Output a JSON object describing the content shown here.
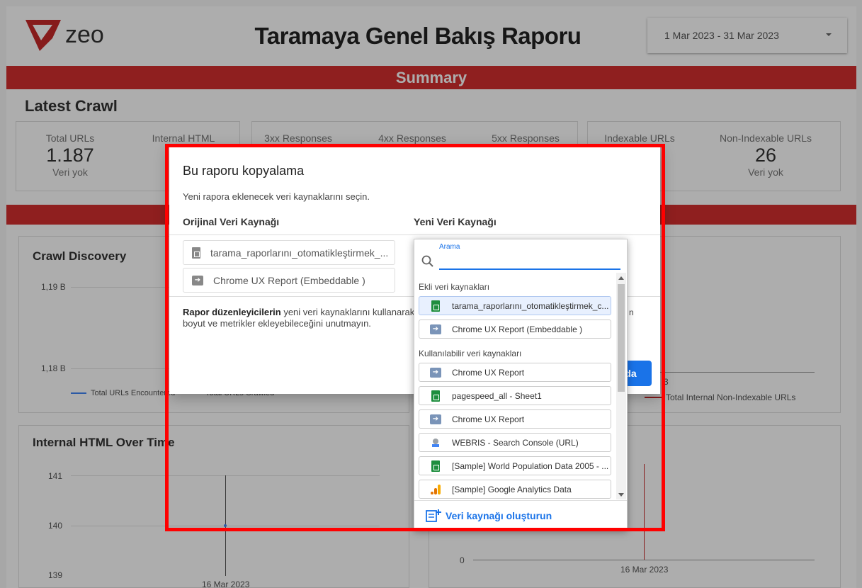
{
  "report": {
    "logo_text": "zeo",
    "title": "Taramaya Genel Bakış Raporu",
    "date_range": "1 Mar 2023 - 31 Mar 2023",
    "summary_band": "Summary",
    "section_title": "Latest Crawl",
    "metrics": [
      {
        "label": "Total URLs",
        "value": "1.187",
        "sub": "Veri yok"
      },
      {
        "label": "Internal HTML",
        "value": "",
        "sub": ""
      },
      {
        "label": "3xx Responses",
        "value": "",
        "sub": ""
      },
      {
        "label": "4xx Responses",
        "value": "",
        "sub": ""
      },
      {
        "label": "5xx Responses",
        "value": "",
        "sub": ""
      },
      {
        "label": "Indexable URLs",
        "value": "",
        "sub": ""
      },
      {
        "label": "Non-Indexable URLs",
        "value": "26",
        "sub": "Veri yok"
      }
    ],
    "crawl_discovery": {
      "title": "Crawl Discovery",
      "y_ticks": [
        "1,19 B",
        "1,18 B"
      ],
      "legend": [
        "Total URLs Encountered",
        "Total URLs Crawled"
      ]
    },
    "internal_html": {
      "title": "Internal HTML Over Time",
      "y_ticks": [
        "141",
        "140",
        "139"
      ],
      "x_tick": "16 Mar 2023"
    },
    "right_chart_top": {
      "x_tick": "3",
      "legend": "Total Internal Non-Indexable URLs"
    },
    "right_chart_bottom": {
      "y_tick": "0",
      "x_tick": "16 Mar 2023"
    }
  },
  "dialog": {
    "title": "Bu raporu kopyalama",
    "description": "Yeni rapora eklenecek veri kaynaklarını seçin.",
    "col_original": "Orijinal Veri Kaynağı",
    "col_new": "Yeni Veri Kaynağı",
    "original_sources": [
      {
        "name": "tarama_raporlarını_otomatikleştirmek_...",
        "icon": "sheet-icon"
      },
      {
        "name": "Chrome UX Report (Embeddable )",
        "icon": "connector-icon"
      }
    ],
    "note_bold": "Rapor düzenleyicilerin",
    "note_rest": " yeni veri kaynaklarını kullanarak g",
    "note_line2": "boyut ve metrikler ekleyebileceğini unutmayın.",
    "note_right_fragment": "n",
    "copy_button": "da"
  },
  "dropdown": {
    "search_label": "Arama",
    "search_value": "",
    "group_added": "Ekli veri kaynakları",
    "added_sources": [
      {
        "name": "tarama_raporlarını_otomatikleştirmek_c...",
        "icon": "sheets-icon",
        "selected": true
      },
      {
        "name": "Chrome UX Report (Embeddable )",
        "icon": "connector-icon",
        "selected": false
      }
    ],
    "group_available": "Kullanılabilir veri kaynakları",
    "available_sources": [
      {
        "name": "Chrome UX Report",
        "icon": "connector-icon"
      },
      {
        "name": "pagespeed_all - Sheet1",
        "icon": "sheets-icon"
      },
      {
        "name": "Chrome UX Report",
        "icon": "connector-icon"
      },
      {
        "name": "WEBRIS - Search Console (URL)",
        "icon": "search-console-icon"
      },
      {
        "name": "[Sample] World Population Data 2005 - ...",
        "icon": "sheets-icon"
      },
      {
        "name": "[Sample] Google Analytics Data",
        "icon": "analytics-icon"
      }
    ],
    "create_label": "Veri kaynağı oluşturun"
  }
}
